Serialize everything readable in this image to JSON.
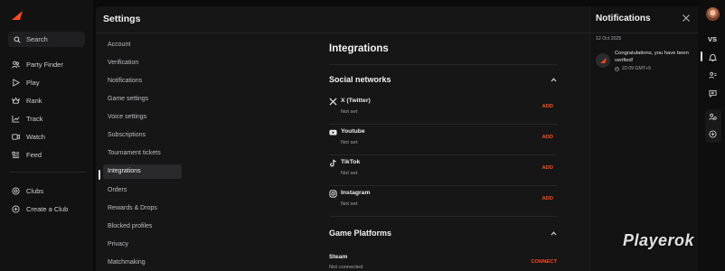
{
  "app": {
    "search_label": "Search",
    "nav": [
      {
        "label": "Party Finder",
        "icon": "party-finder-icon"
      },
      {
        "label": "Play",
        "icon": "play-icon"
      },
      {
        "label": "Rank",
        "icon": "rank-icon"
      },
      {
        "label": "Track",
        "icon": "track-icon"
      },
      {
        "label": "Watch",
        "icon": "watch-icon"
      },
      {
        "label": "Feed",
        "icon": "feed-icon"
      }
    ],
    "clubs": [
      {
        "label": "Clubs",
        "icon": "clubs-icon"
      },
      {
        "label": "Create a Club",
        "icon": "create-club-icon"
      }
    ],
    "brand_color": "#ff4a1c"
  },
  "settings": {
    "title": "Settings",
    "menu": [
      "Account",
      "Verification",
      "Notifications",
      "Game settings",
      "Voice settings",
      "Subscriptions",
      "Tournament tickets",
      "Integrations",
      "Orders",
      "Rewards & Drops",
      "Blocked profiles",
      "Privacy",
      "Matchmaking"
    ],
    "active_menu": "Integrations",
    "page_heading": "Integrations",
    "social_title": "Social networks",
    "socials": [
      {
        "name": "X (Twitter)",
        "status": "Not set",
        "action": "ADD",
        "icon": "x-twitter-icon"
      },
      {
        "name": "Youtube",
        "status": "Not set",
        "action": "ADD",
        "icon": "youtube-icon"
      },
      {
        "name": "TikTok",
        "status": "Not set",
        "action": "ADD",
        "icon": "tiktok-icon"
      },
      {
        "name": "Instagram",
        "status": "Not set",
        "action": "ADD",
        "icon": "instagram-icon"
      }
    ],
    "platforms_title": "Game Platforms",
    "platforms": [
      {
        "name": "Steam",
        "status": "Not connected",
        "action": "CONNECT"
      }
    ]
  },
  "notifications": {
    "title": "Notifications",
    "items": [
      {
        "date": "12 Oct 2025",
        "message": "Congratulations, you have been verified!",
        "time": "22:09 GMT+9"
      }
    ]
  },
  "rail": {
    "vs_label": "VS",
    "icons": [
      "bell-icon",
      "friends-icon",
      "chat-icon",
      "group-settings-icon",
      "add-circle-icon"
    ]
  },
  "watermark": "Playerok"
}
